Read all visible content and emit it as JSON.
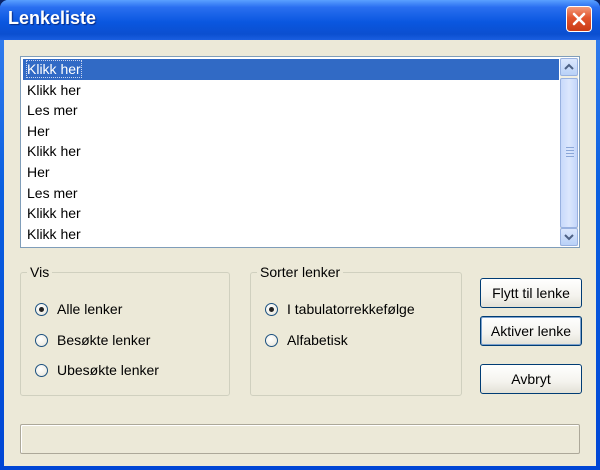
{
  "window": {
    "title": "Lenkeliste"
  },
  "list": {
    "items": [
      "Klikk her",
      "Klikk her",
      "Les mer",
      "Her",
      "Klikk her",
      "Her",
      "Les mer",
      "Klikk her",
      "Klikk her"
    ],
    "selected_index": 0
  },
  "groups": {
    "vis": {
      "label": "Vis",
      "options": [
        "Alle lenker",
        "Besøkte lenker",
        "Ubesøkte lenker"
      ],
      "selected_index": 0
    },
    "sorter": {
      "label": "Sorter lenker",
      "options": [
        "I tabulatorrekkefølge",
        "Alfabetisk"
      ],
      "selected_index": 0
    }
  },
  "buttons": {
    "flytt": "Flytt til lenke",
    "aktiver": "Aktiver lenke",
    "avbryt": "Avbryt"
  },
  "status": {
    "text": ""
  },
  "colors": {
    "selection": "#316ac5",
    "title_bar": "#0a57e0",
    "client": "#ece9d8"
  }
}
